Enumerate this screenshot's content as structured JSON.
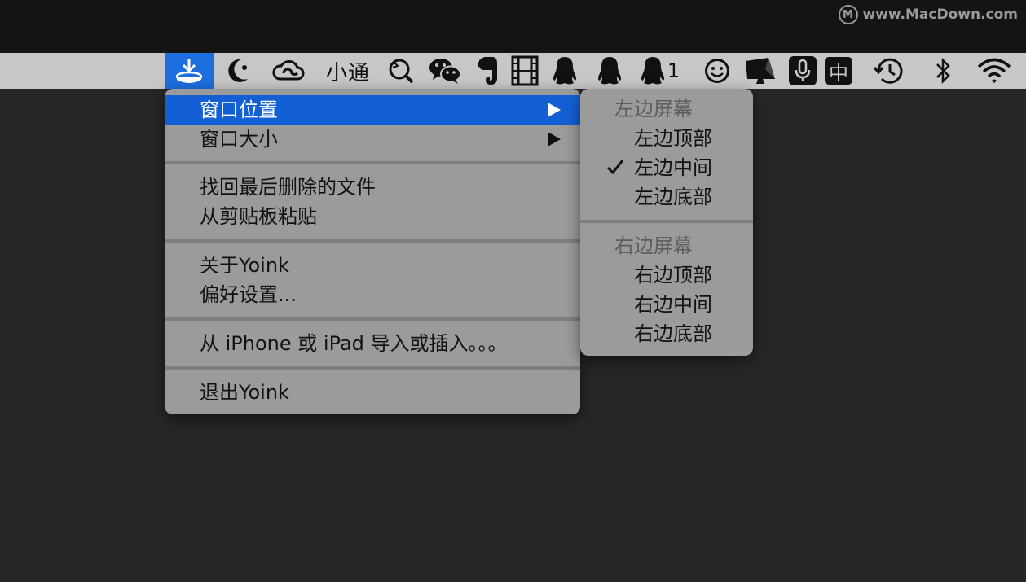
{
  "watermark": {
    "logo_letter": "M",
    "text": "www.MacDown.com"
  },
  "menubar": {
    "items": [
      {
        "name": "yoink-download-icon",
        "active": true
      },
      {
        "name": "moon-wallpaper-icon"
      },
      {
        "name": "creative-cloud-icon"
      },
      {
        "name": "xiaotong-text",
        "text": "小通"
      },
      {
        "name": "magnifier-search-icon"
      },
      {
        "name": "wechat-icon"
      },
      {
        "name": "evernote-elephant-icon"
      },
      {
        "name": "film-strip-icon"
      },
      {
        "name": "qq-penguin-icon"
      },
      {
        "name": "qq-penguin-icon-2"
      },
      {
        "name": "qq-penguin-icon-3",
        "badge": "1"
      },
      {
        "name": "smiley-face-icon"
      },
      {
        "name": "screen-display-icon"
      },
      {
        "name": "microphone-icon"
      },
      {
        "name": "chinese-input-icon",
        "text": "中"
      },
      {
        "name": "time-machine-icon"
      },
      {
        "name": "bluetooth-icon"
      },
      {
        "name": "wifi-icon"
      }
    ]
  },
  "main_menu": {
    "items": [
      {
        "label": "窗口位置"
      },
      {
        "label": "窗口大小"
      },
      {
        "label": "找回最后删除的文件"
      },
      {
        "label": "从剪贴板粘贴"
      },
      {
        "label": "关于Yoink"
      },
      {
        "label": "偏好设置..."
      },
      {
        "label": "从 iPhone 或 iPad 导入或插入。。。"
      },
      {
        "label": "退出Yoink"
      }
    ]
  },
  "submenu": {
    "left_header": "左边屏幕",
    "left_items": [
      {
        "label": "左边顶部"
      },
      {
        "label": "左边中间",
        "checked": true
      },
      {
        "label": "左边底部"
      }
    ],
    "right_header": "右边屏幕",
    "right_items": [
      {
        "label": "右边顶部"
      },
      {
        "label": "右边中间"
      },
      {
        "label": "右边底部"
      }
    ]
  },
  "colors": {
    "highlight": "#1360d4",
    "active_icon_bg": "#1d6fe0",
    "menubar_bg": "#c7c7c7",
    "menu_bg": "#9b9b9b"
  }
}
